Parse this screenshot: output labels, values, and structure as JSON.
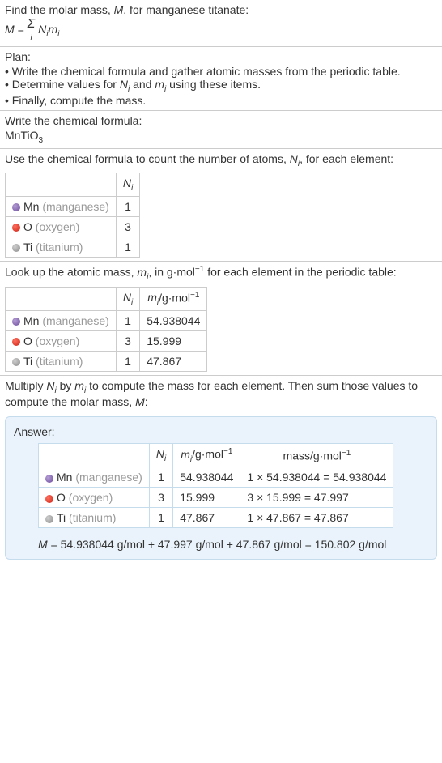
{
  "intro": {
    "title": "Find the molar mass, M, for manganese titanate:",
    "formula": "M = Σ Nᵢmᵢ",
    "formula_i": "i"
  },
  "plan": {
    "title": "Plan:",
    "items": [
      "Write the chemical formula and gather atomic masses from the periodic table.",
      "Determine values for Nᵢ and mᵢ using these items.",
      "Finally, compute the mass."
    ]
  },
  "formula_section": {
    "title": "Write the chemical formula:",
    "formula_main": "MnTiO",
    "formula_sub": "3"
  },
  "count_section": {
    "title": "Use the chemical formula to count the number of atoms, Nᵢ, for each element:",
    "header_ni": "Nᵢ",
    "rows": [
      {
        "dot": "mn",
        "symbol": "Mn",
        "name": "(manganese)",
        "ni": "1"
      },
      {
        "dot": "o",
        "symbol": "O",
        "name": "(oxygen)",
        "ni": "3"
      },
      {
        "dot": "ti",
        "symbol": "Ti",
        "name": "(titanium)",
        "ni": "1"
      }
    ]
  },
  "mass_section": {
    "title": "Look up the atomic mass, mᵢ, in g·mol⁻¹ for each element in the periodic table:",
    "header_ni": "Nᵢ",
    "header_mi": "mᵢ/g·mol⁻¹",
    "rows": [
      {
        "dot": "mn",
        "symbol": "Mn",
        "name": "(manganese)",
        "ni": "1",
        "mi": "54.938044"
      },
      {
        "dot": "o",
        "symbol": "O",
        "name": "(oxygen)",
        "ni": "3",
        "mi": "15.999"
      },
      {
        "dot": "ti",
        "symbol": "Ti",
        "name": "(titanium)",
        "ni": "1",
        "mi": "47.867"
      }
    ]
  },
  "compute_section": {
    "title": "Multiply Nᵢ by mᵢ to compute the mass for each element. Then sum those values to compute the molar mass, M:"
  },
  "answer": {
    "title": "Answer:",
    "header_ni": "Nᵢ",
    "header_mi": "mᵢ/g·mol⁻¹",
    "header_mass": "mass/g·mol⁻¹",
    "rows": [
      {
        "dot": "mn",
        "symbol": "Mn",
        "name": "(manganese)",
        "ni": "1",
        "mi": "54.938044",
        "mass": "1 × 54.938044 = 54.938044"
      },
      {
        "dot": "o",
        "symbol": "O",
        "name": "(oxygen)",
        "ni": "3",
        "mi": "15.999",
        "mass": "3 × 15.999 = 47.997"
      },
      {
        "dot": "ti",
        "symbol": "Ti",
        "name": "(titanium)",
        "ni": "1",
        "mi": "47.867",
        "mass": "1 × 47.867 = 47.867"
      }
    ],
    "final": "M = 54.938044 g/mol + 47.997 g/mol + 47.867 g/mol = 150.802 g/mol"
  }
}
